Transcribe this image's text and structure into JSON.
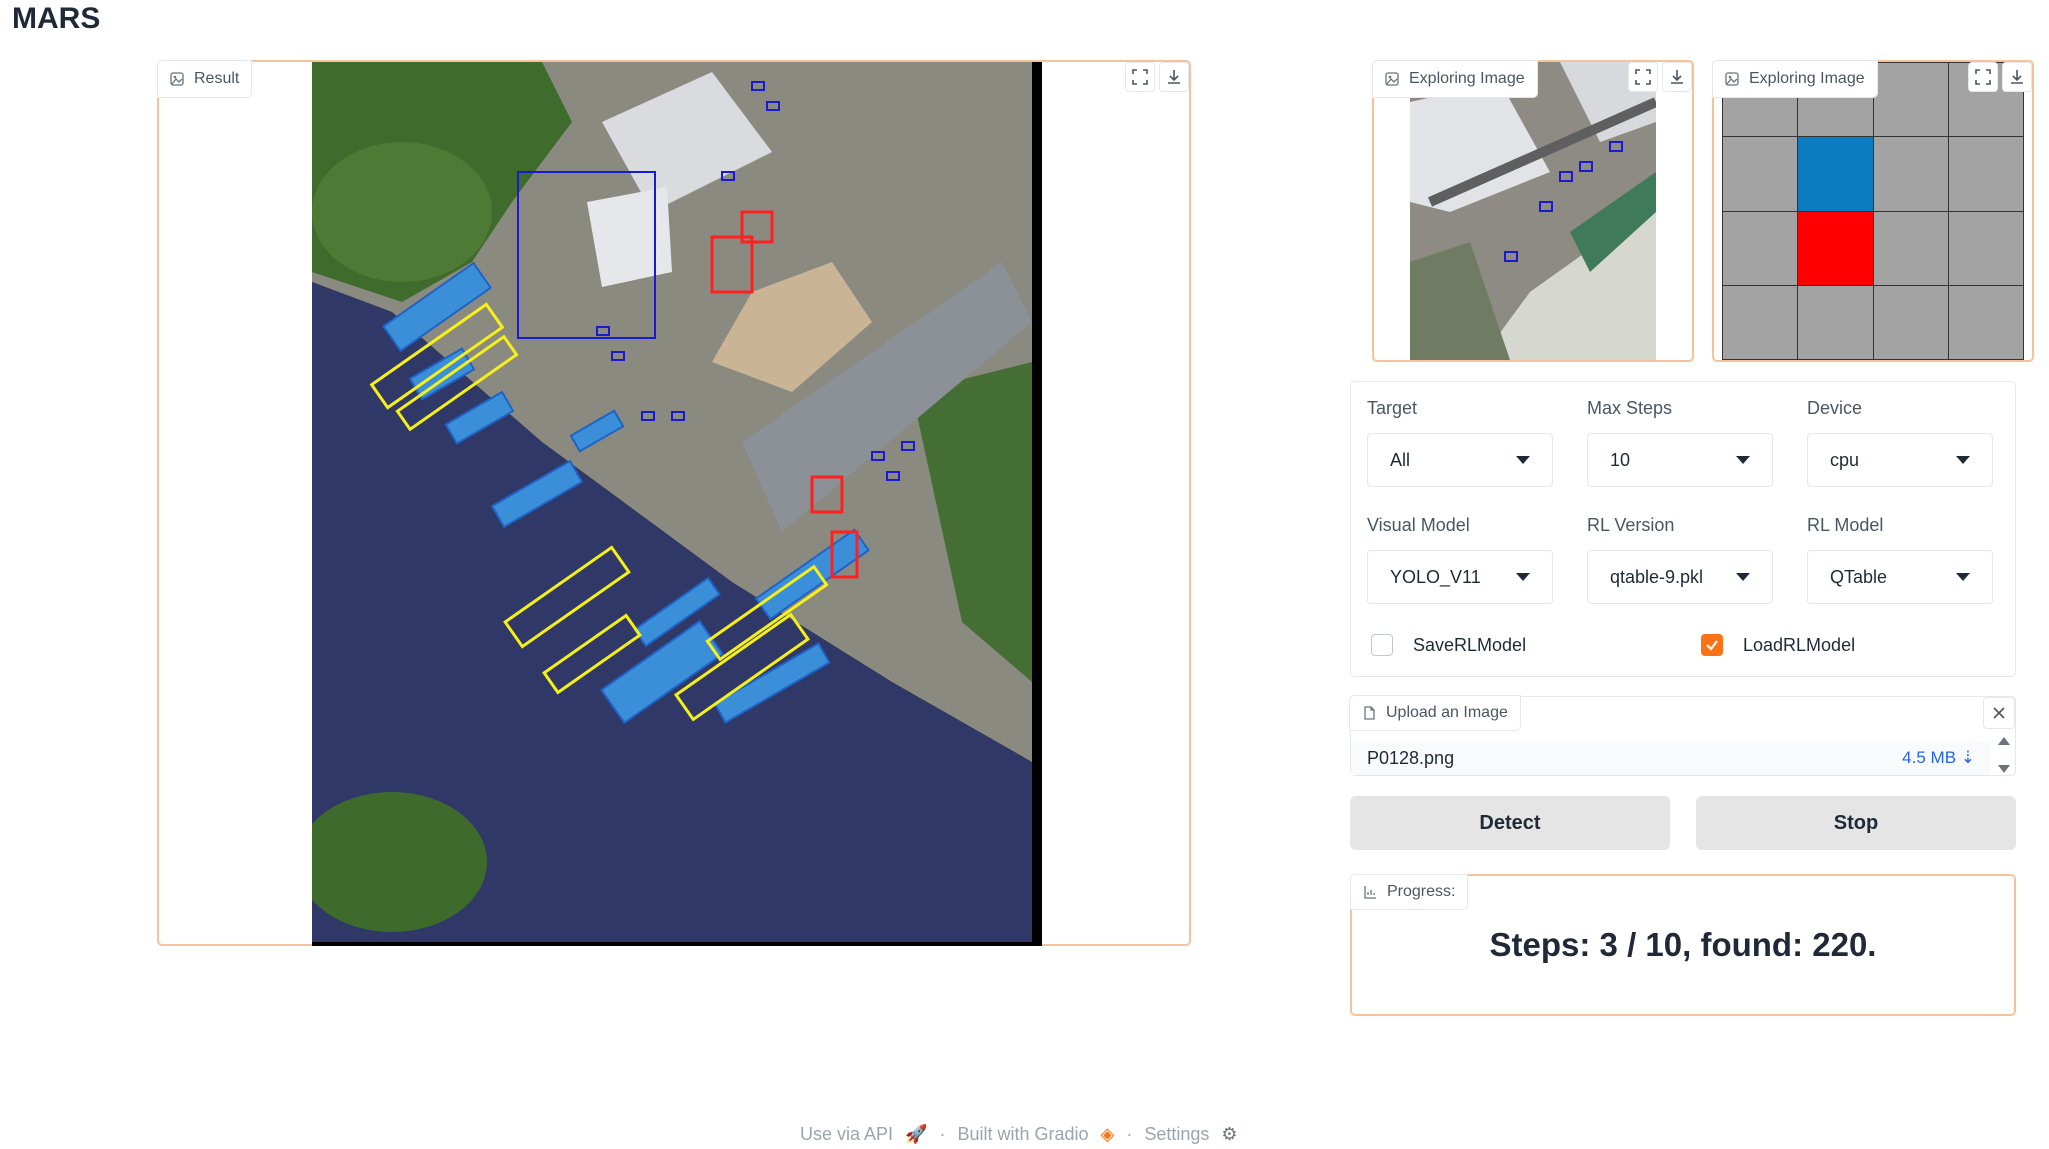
{
  "app": {
    "title": "MARS"
  },
  "result": {
    "label": "Result"
  },
  "exploring": [
    {
      "label": "Exploring Image"
    },
    {
      "label": "Exploring Image"
    }
  ],
  "grid_panel": {
    "cells": [
      "gray",
      "gray",
      "gray",
      "gray",
      "gray",
      "blue",
      "gray",
      "gray",
      "gray",
      "red",
      "gray",
      "gray",
      "gray",
      "gray",
      "gray",
      "gray"
    ],
    "colors": {
      "gray": "#a3a3a3",
      "blue": "#0c7bbf",
      "red": "#ff0000"
    }
  },
  "form": {
    "target": {
      "label": "Target",
      "value": "All"
    },
    "max_steps": {
      "label": "Max Steps",
      "value": "10"
    },
    "device": {
      "label": "Device",
      "value": "cpu"
    },
    "visual_model": {
      "label": "Visual Model",
      "value": "YOLO_V11"
    },
    "rl_version": {
      "label": "RL Version",
      "value": "qtable-9.pkl"
    },
    "rl_model": {
      "label": "RL Model",
      "value": "QTable"
    },
    "save_rl_model": {
      "label": "SaveRLModel",
      "checked": false
    },
    "load_rl_model": {
      "label": "LoadRLModel",
      "checked": true
    }
  },
  "upload": {
    "label": "Upload an Image",
    "file_name": "P0128.png",
    "file_size": "4.5 MB ⇣"
  },
  "buttons": {
    "detect": "Detect",
    "stop": "Stop"
  },
  "progress": {
    "label": "Progress:",
    "text": "Steps: 3 / 10, found: 220."
  },
  "footer": {
    "api": "Use via API",
    "built": "Built with Gradio",
    "settings": "Settings",
    "sep": "·"
  },
  "colors": {
    "accent": "#f97316",
    "panel_border": "#f7c29a",
    "detection_blue": "#1a1ad0"
  }
}
